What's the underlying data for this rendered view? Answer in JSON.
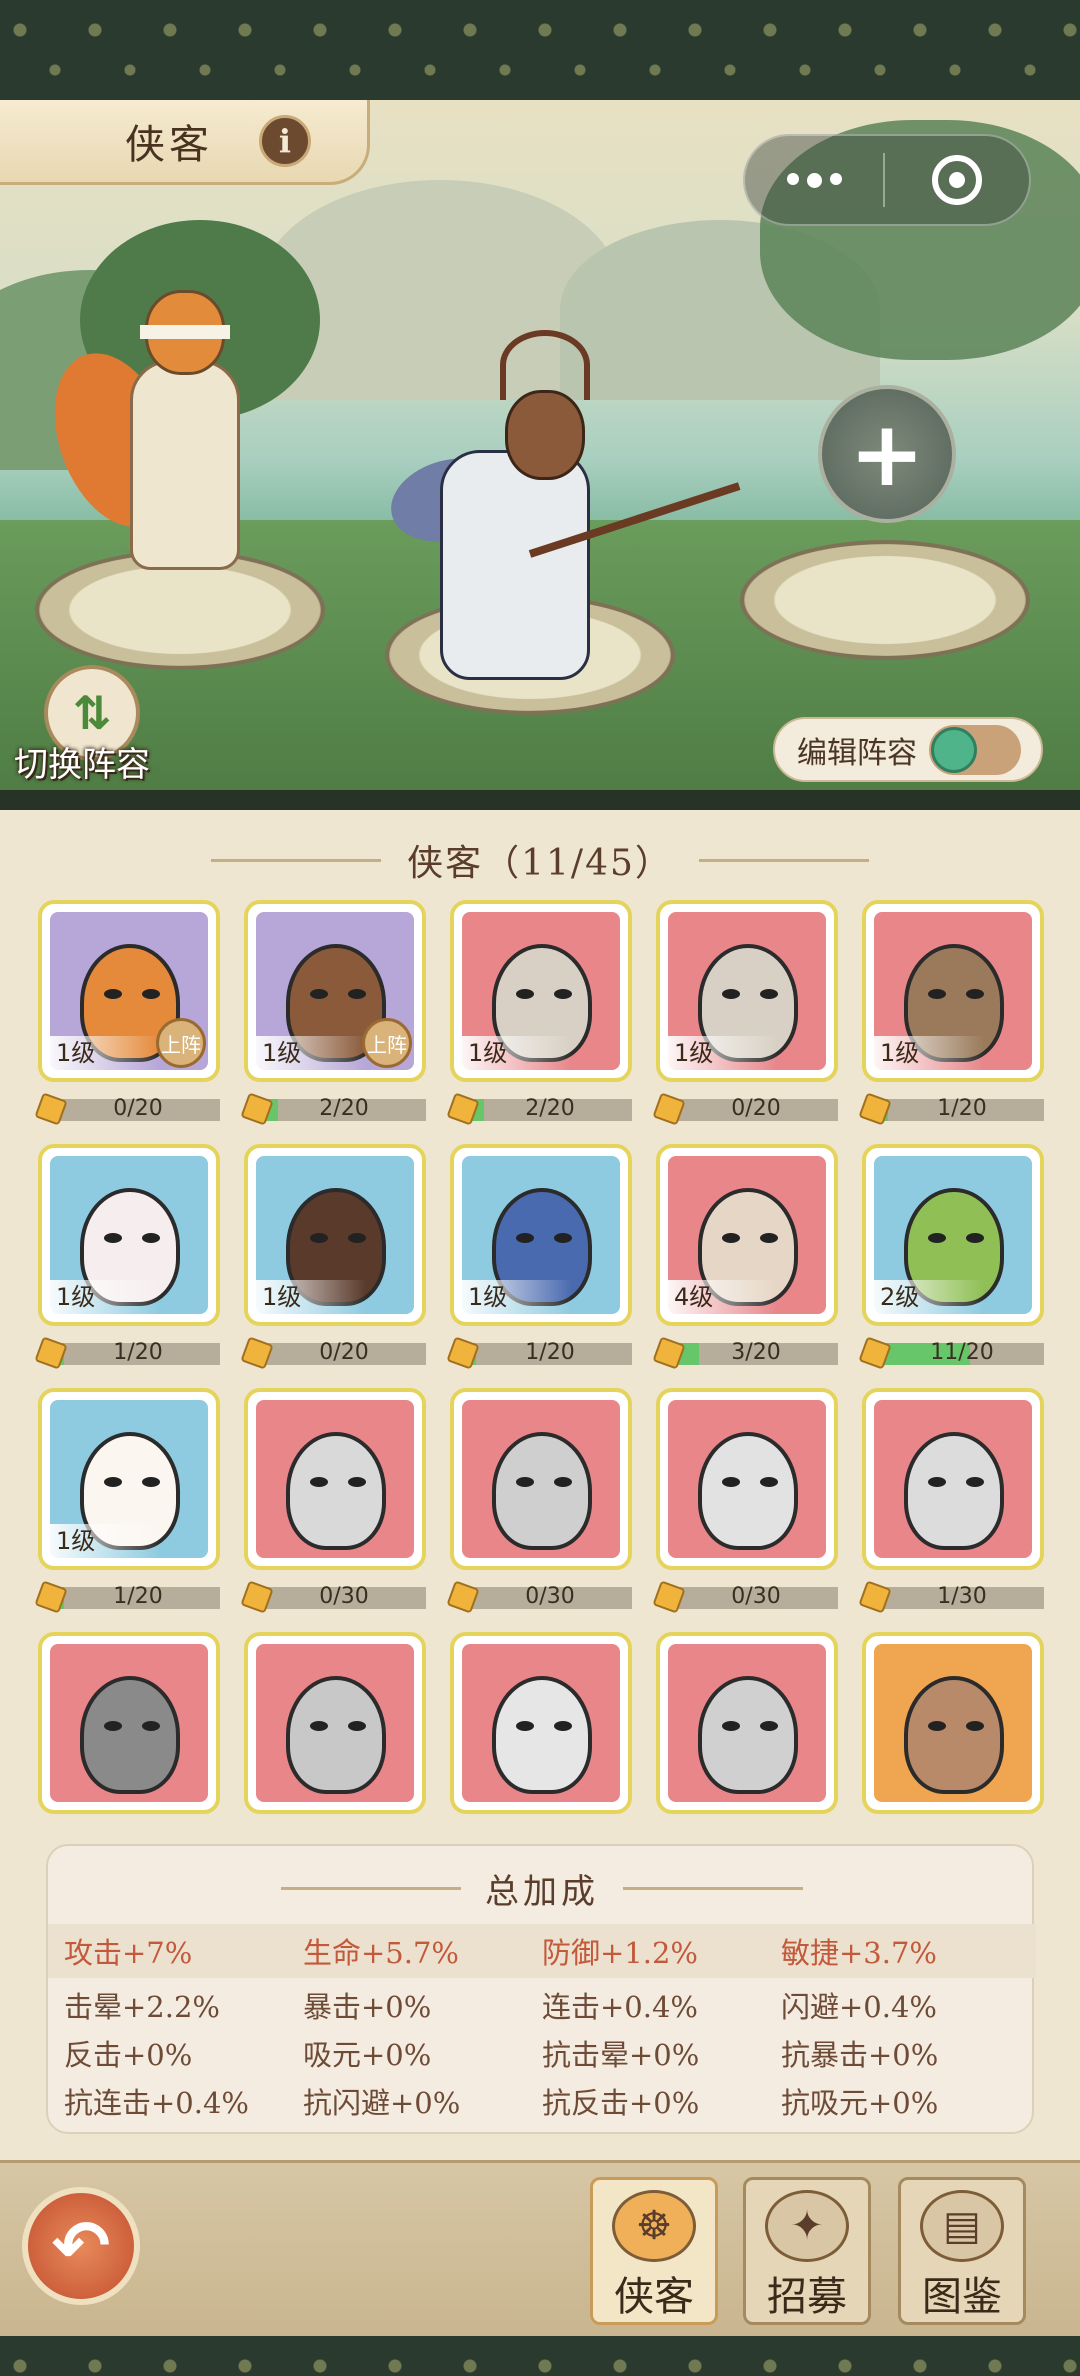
{
  "header": {
    "title": "侠客",
    "info_icon": "i"
  },
  "capsule": {
    "more_icon": "more-dots-icon",
    "close_icon": "target-icon"
  },
  "scene": {
    "plus_label": "+",
    "switch_label": "切换阵容",
    "edit_label": "编辑阵容",
    "edit_toggle_on": true
  },
  "roster": {
    "title": "侠客（11/45）",
    "cards": [
      {
        "level": "1级",
        "progress": "0/20",
        "fill": 0,
        "badge": "上阵",
        "color": "#b7a6d8",
        "face": "#e58a3a"
      },
      {
        "level": "1级",
        "progress": "2/20",
        "fill": 0.1,
        "badge": "上阵",
        "color": "#b7a6d8",
        "face": "#8a5a3a"
      },
      {
        "level": "1级",
        "progress": "2/20",
        "fill": 0.1,
        "badge": "",
        "color": "#e8868a",
        "face": "#d8d0c4"
      },
      {
        "level": "1级",
        "progress": "0/20",
        "fill": 0,
        "badge": "",
        "color": "#e8868a",
        "face": "#d8d0c4"
      },
      {
        "level": "1级",
        "progress": "1/20",
        "fill": 0.05,
        "badge": "",
        "color": "#e8868a",
        "face": "#9a7a5a"
      },
      {
        "level": "1级",
        "progress": "1/20",
        "fill": 0.05,
        "badge": "",
        "color": "#8ecbe0",
        "face": "#f6eeee"
      },
      {
        "level": "1级",
        "progress": "0/20",
        "fill": 0,
        "badge": "",
        "color": "#8ecbe0",
        "face": "#5a3a2a"
      },
      {
        "level": "1级",
        "progress": "1/20",
        "fill": 0.05,
        "badge": "",
        "color": "#8ecbe0",
        "face": "#4a6ab0"
      },
      {
        "level": "4级",
        "progress": "3/20",
        "fill": 0.15,
        "badge": "",
        "color": "#e8868a",
        "face": "#e6d6c6"
      },
      {
        "level": "2级",
        "progress": "11/20",
        "fill": 0.55,
        "badge": "",
        "color": "#8ecbe0",
        "face": "#8fbf55"
      },
      {
        "level": "1级",
        "progress": "1/20",
        "fill": 0.05,
        "badge": "",
        "color": "#8ecbe0",
        "face": "#fbf6f0"
      },
      {
        "level": "",
        "progress": "0/30",
        "fill": 0,
        "badge": "",
        "color": "#e8868a",
        "face": "#d9d9d9"
      },
      {
        "level": "",
        "progress": "0/30",
        "fill": 0,
        "badge": "",
        "color": "#e8868a",
        "face": "#cfcfcf"
      },
      {
        "level": "",
        "progress": "0/30",
        "fill": 0,
        "badge": "",
        "color": "#e8868a",
        "face": "#e2e2e2"
      },
      {
        "level": "",
        "progress": "1/30",
        "fill": 0.033,
        "badge": "",
        "color": "#e8868a",
        "face": "#dcdcdc"
      },
      {
        "level": "",
        "progress": "",
        "fill": 0,
        "badge": "",
        "color": "#e8868a",
        "face": "#8a8a8a"
      },
      {
        "level": "",
        "progress": "",
        "fill": 0,
        "badge": "",
        "color": "#e8868a",
        "face": "#c8c8c8"
      },
      {
        "level": "",
        "progress": "",
        "fill": 0,
        "badge": "",
        "color": "#e8868a",
        "face": "#e6e6e6"
      },
      {
        "level": "",
        "progress": "",
        "fill": 0,
        "badge": "",
        "color": "#e8868a",
        "face": "#d0d0d0"
      },
      {
        "level": "",
        "progress": "",
        "fill": 0,
        "badge": "",
        "color": "#f0a650",
        "face": "#b88a6a"
      }
    ]
  },
  "bonus": {
    "title": "总加成",
    "main": [
      "攻击+7%",
      "生命+5.7%",
      "防御+1.2%",
      "敏捷+3.7%"
    ],
    "rows": [
      [
        "击晕+2.2%",
        "暴击+0%",
        "连击+0.4%",
        "闪避+0.4%"
      ],
      [
        "反击+0%",
        "吸元+0%",
        "抗击晕+0%",
        "抗暴击+0%"
      ],
      [
        "抗连击+0.4%",
        "抗闪避+0%",
        "抗反击+0%",
        "抗吸元+0%"
      ]
    ]
  },
  "nav": {
    "back_icon": "↶",
    "items": [
      {
        "label": "侠客",
        "active": true,
        "icon": "warrior-icon"
      },
      {
        "label": "招募",
        "active": false,
        "icon": "recruit-icon"
      },
      {
        "label": "图鉴",
        "active": false,
        "icon": "book-icon"
      }
    ]
  }
}
